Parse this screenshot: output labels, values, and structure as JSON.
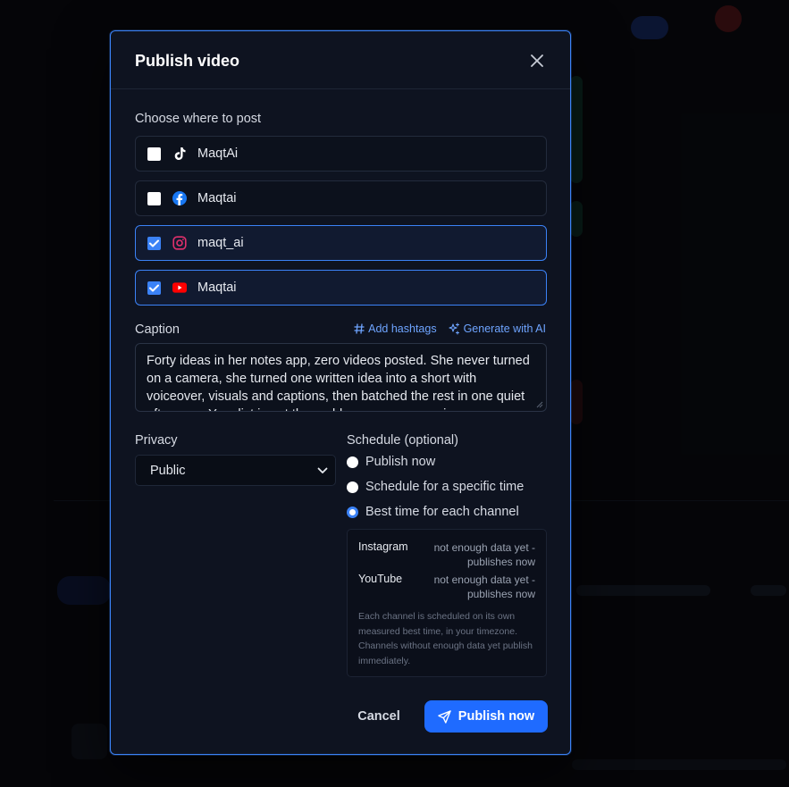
{
  "modal": {
    "title": "Publish video",
    "choose_label": "Choose where to post",
    "channels": [
      {
        "name": "MaqtAi",
        "icon": "tiktok-icon",
        "checked": false
      },
      {
        "name": "Maqtai",
        "icon": "facebook-icon",
        "checked": false
      },
      {
        "name": "maqt_ai",
        "icon": "instagram-icon",
        "checked": true
      },
      {
        "name": "Maqtai",
        "icon": "youtube-icon",
        "checked": true
      }
    ],
    "caption": {
      "label": "Caption",
      "add_hashtags": "Add hashtags",
      "generate_ai": "Generate with AI",
      "text": "Forty ideas in her notes app, zero videos posted. She never turned on a camera, she turned one written idea into a short with voiceover, visuals and captions, then batched the rest in one quiet afternoon. Your list is not the problem, your camera is."
    },
    "privacy": {
      "label": "Privacy",
      "value": "Public"
    },
    "schedule": {
      "label": "Schedule (optional)",
      "options": [
        {
          "label": "Publish now",
          "selected": false
        },
        {
          "label": "Schedule for a specific time",
          "selected": false
        },
        {
          "label": "Best time for each channel",
          "selected": true
        }
      ],
      "best_time": [
        {
          "channel": "Instagram",
          "value": "not enough data yet - publishes now"
        },
        {
          "channel": "YouTube",
          "value": "not enough data yet - publishes now"
        }
      ],
      "note": "Each channel is scheduled on its own measured best time, in your timezone. Channels without enough data yet publish immediately."
    },
    "cancel_label": "Cancel",
    "publish_label": "Publish now"
  },
  "colors": {
    "accent": "#3b82f6",
    "primary_button": "#1f6bff",
    "instagram": "#e1306c",
    "youtube": "#ff0000",
    "facebook": "#1877f2"
  }
}
